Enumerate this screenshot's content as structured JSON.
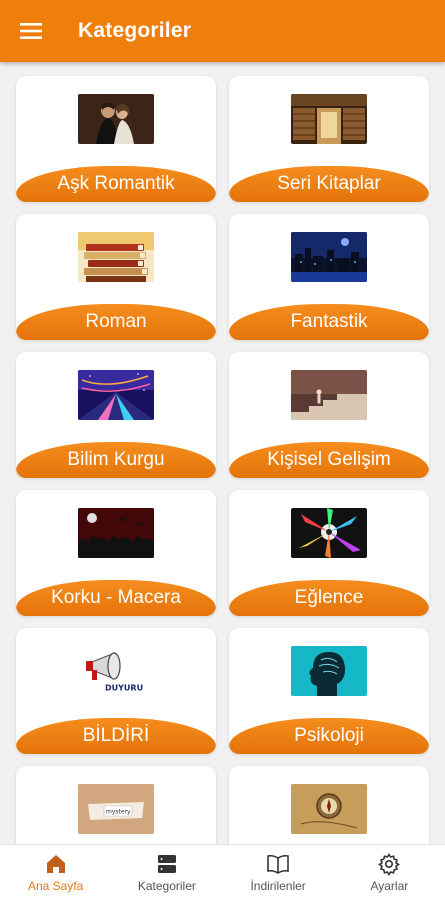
{
  "appbar": {
    "title": "Kategoriler",
    "menu_icon": "hamburger-menu-icon",
    "color": "#f07e0a"
  },
  "categories": [
    {
      "label": "Aşk Romantik",
      "image": "romantic-couple-image"
    },
    {
      "label": "Seri Kitaplar",
      "image": "library-shelves-image"
    },
    {
      "label": "Roman",
      "image": "book-stack-image"
    },
    {
      "label": "Fantastik",
      "image": "fantasy-night-city-image"
    },
    {
      "label": "Bilim Kurgu",
      "image": "scifi-neon-image"
    },
    {
      "label": "Kişisel Gelişim",
      "image": "stairs-climb-image"
    },
    {
      "label": "Korku - Macera",
      "image": "horror-red-crowd-image"
    },
    {
      "label": "Eğlence",
      "image": "party-splash-image"
    },
    {
      "label": "BİLDİRİ",
      "image": "megaphone-duyuru-image"
    },
    {
      "label": "Psikoloji",
      "image": "head-silhouette-image"
    },
    {
      "label": "",
      "image": "mystery-paper-image"
    },
    {
      "label": "",
      "image": "compass-map-image"
    }
  ],
  "thumb_text": {
    "duyuru": "DUYURU",
    "mystery": "mystery"
  },
  "bottom_nav": [
    {
      "label": "Ana Sayfa",
      "icon": "home-icon",
      "active": true
    },
    {
      "label": "Kategoriler",
      "icon": "stacked-list-icon",
      "active": false
    },
    {
      "label": "İndirilenler",
      "icon": "open-book-icon",
      "active": false
    },
    {
      "label": "Ayarlar",
      "icon": "gear-icon",
      "active": false
    }
  ]
}
